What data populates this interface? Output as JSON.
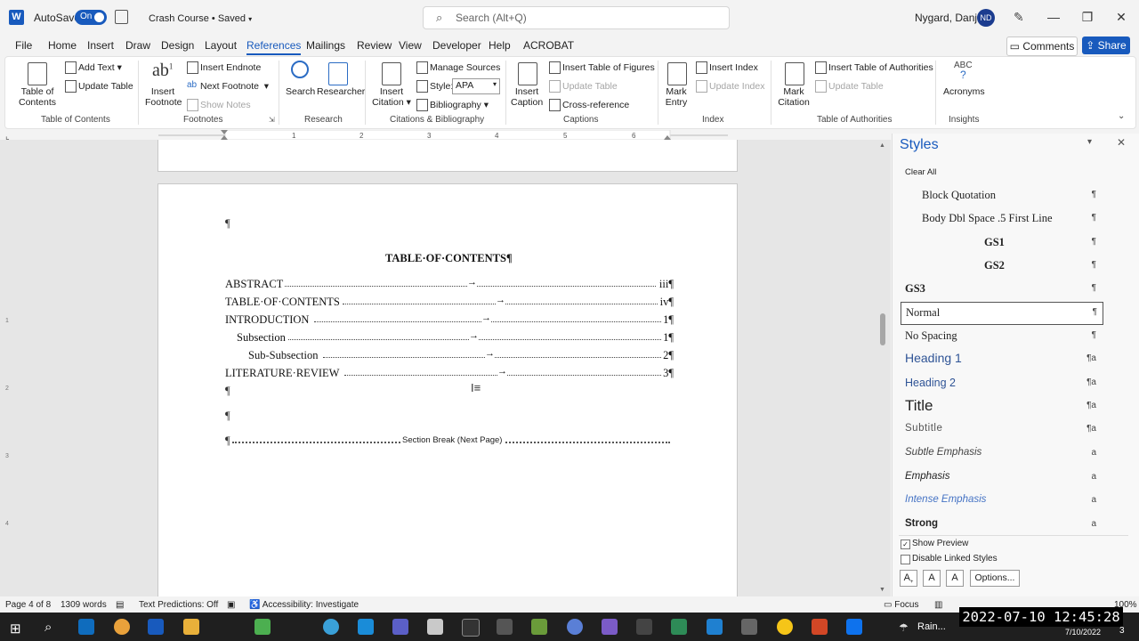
{
  "titlebar": {
    "autosave_label": "AutoSave",
    "autosave_state": "On",
    "doc_title": "Crash Course • Saved",
    "search_placeholder": "Search (Alt+Q)",
    "user_name": "Nygard, Danjel",
    "user_initials": "ND"
  },
  "menu": [
    "File",
    "Home",
    "Insert",
    "Draw",
    "Design",
    "Layout",
    "References",
    "Mailings",
    "Review",
    "View",
    "Developer",
    "Help",
    "ACROBAT"
  ],
  "menu_active": "References",
  "actions": {
    "comments": "Comments",
    "share": "Share"
  },
  "ribbon": {
    "toc": {
      "big": "Table of Contents",
      "add_text": "Add Text",
      "update_table": "Update Table",
      "group": "Table of Contents"
    },
    "footnotes": {
      "insert_footnote": "Insert Footnote",
      "insert_endnote": "Insert Endnote",
      "next_footnote": "Next Footnote",
      "show_notes": "Show Notes",
      "group": "Footnotes"
    },
    "research": {
      "search": "Search",
      "researcher": "Researcher",
      "group": "Research"
    },
    "citations": {
      "insert_citation": "Insert Citation",
      "manage_sources": "Manage Sources",
      "style_label": "Style:",
      "style_value": "APA",
      "bibliography": "Bibliography",
      "group": "Citations & Bibliography"
    },
    "captions": {
      "insert_caption": "Insert Caption",
      "insert_tof": "Insert Table of Figures",
      "update_table": "Update Table",
      "cross_reference": "Cross-reference",
      "group": "Captions"
    },
    "index": {
      "mark_entry": "Mark Entry",
      "insert_index": "Insert Index",
      "update_index": "Update Index",
      "group": "Index"
    },
    "toa": {
      "mark_citation": "Mark Citation",
      "insert_toa": "Insert Table of Authorities",
      "update_table": "Update Table",
      "group": "Table of Authorities"
    },
    "insights": {
      "acronyms": "Acronyms",
      "group": "Insights"
    }
  },
  "document": {
    "heading": "TABLE·OF·CONTENTS¶",
    "toc_entries": [
      {
        "label": "ABSTRACT",
        "page": "iii¶"
      },
      {
        "label": "TABLE·OF·CONTENTS",
        "page": "iv¶"
      },
      {
        "label": "INTRODUCTION",
        "page": "1¶"
      },
      {
        "label": "Subsection",
        "page": "1¶"
      },
      {
        "label": "Sub-Subsection",
        "page": "2¶"
      },
      {
        "label": "LITERATURE·REVIEW",
        "page": "3¶"
      }
    ],
    "pilcrow": "¶",
    "section_break": "Section Break (Next Page)"
  },
  "styles_pane": {
    "title": "Styles",
    "clear_all": "Clear All",
    "items": [
      {
        "name": "Block Quotation",
        "mark": "¶"
      },
      {
        "name": "Body Dbl Space .5 First Line",
        "mark": "¶"
      },
      {
        "name": "GS1",
        "mark": "¶"
      },
      {
        "name": "GS2",
        "mark": "¶"
      },
      {
        "name": "GS3",
        "mark": "¶"
      },
      {
        "name": "Normal",
        "mark": "¶"
      },
      {
        "name": "No Spacing",
        "mark": "¶"
      },
      {
        "name": "Heading 1",
        "mark": "¶a"
      },
      {
        "name": "Heading 2",
        "mark": "¶a"
      },
      {
        "name": "Title",
        "mark": "¶a"
      },
      {
        "name": "Subtitle",
        "mark": "¶a"
      },
      {
        "name": "Subtle Emphasis",
        "mark": "a"
      },
      {
        "name": "Emphasis",
        "mark": "a"
      },
      {
        "name": "Intense Emphasis",
        "mark": "a"
      },
      {
        "name": "Strong",
        "mark": "a"
      }
    ],
    "selected": "Normal",
    "show_preview": "Show Preview",
    "disable_linked": "Disable Linked Styles",
    "options": "Options..."
  },
  "statusbar": {
    "page": "Page 4 of 8",
    "words": "1309 words",
    "text_predictions": "Text Predictions: Off",
    "accessibility": "Accessibility: Investigate",
    "focus": "Focus",
    "zoom": "100%"
  },
  "taskbar": {
    "weather": "Rain...",
    "date": "7/10/2022",
    "notifications": "3"
  },
  "overlay_clock": "2022-07-10  12:45:28",
  "colors": {
    "accent": "#185abd",
    "ribbon_bg": "#ffffff",
    "doc_bg": "#e6e6e6"
  }
}
